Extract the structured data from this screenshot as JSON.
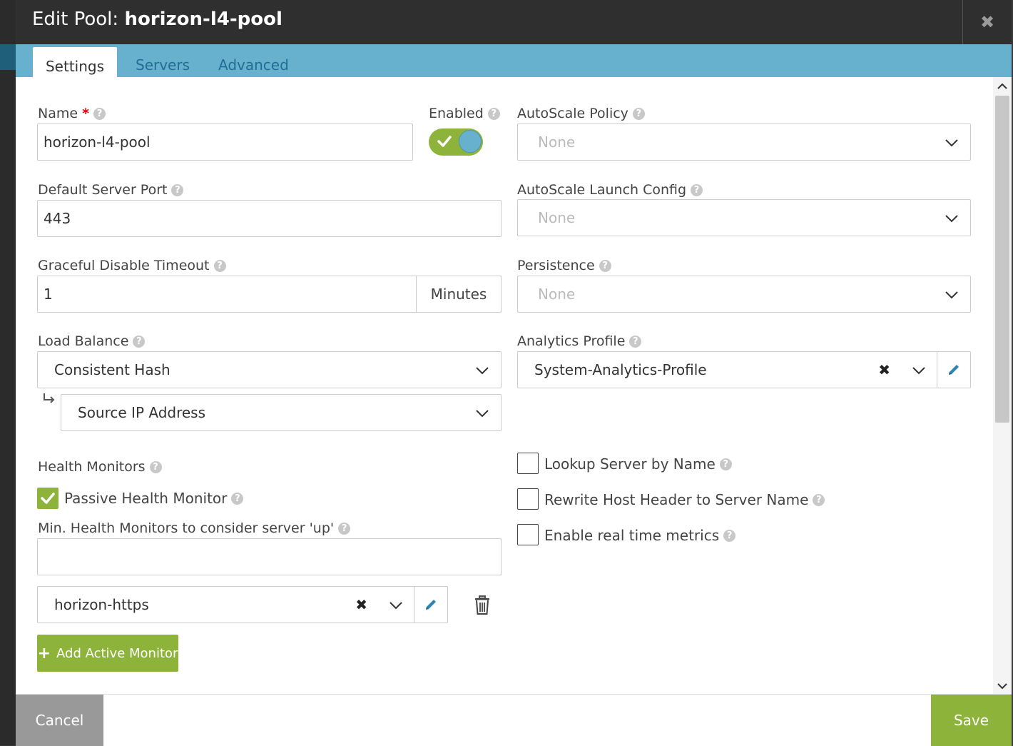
{
  "dialog": {
    "title_prefix": "Edit Pool: ",
    "title_name": "horizon-l4-pool",
    "close_symbol": "✖"
  },
  "tabs": [
    {
      "label": "Settings",
      "active": true
    },
    {
      "label": "Servers",
      "active": false
    },
    {
      "label": "Advanced",
      "active": false
    }
  ],
  "form": {
    "name": {
      "label": "Name",
      "required_mark": "*",
      "value": "horizon-l4-pool"
    },
    "enabled": {
      "label": "Enabled",
      "value": true
    },
    "autoscale_policy": {
      "label": "AutoScale Policy",
      "value": "None"
    },
    "default_server_port": {
      "label": "Default Server Port",
      "value": "443"
    },
    "autoscale_launch_config": {
      "label": "AutoScale Launch Config",
      "value": "None"
    },
    "graceful_disable_timeout": {
      "label": "Graceful Disable Timeout",
      "value": "1",
      "unit": "Minutes"
    },
    "persistence": {
      "label": "Persistence",
      "value": "None"
    },
    "load_balance": {
      "label": "Load Balance",
      "value": "Consistent Hash",
      "sub_value": "Source IP Address"
    },
    "analytics_profile": {
      "label": "Analytics Profile",
      "value": "System-Analytics-Profile"
    },
    "health_monitors": {
      "label": "Health Monitors"
    },
    "passive_health_monitor": {
      "label": "Passive Health Monitor",
      "checked": true
    },
    "min_health_monitors": {
      "label": "Min. Health Monitors to consider server 'up'",
      "value": ""
    },
    "active_monitor": {
      "value": "horizon-https"
    },
    "add_active_monitor": {
      "label": "Add Active Monitor"
    },
    "lookup_server_by_name": {
      "label": "Lookup Server by Name",
      "checked": false
    },
    "rewrite_host_header": {
      "label": "Rewrite Host Header to Server Name",
      "checked": false
    },
    "enable_real_time_metrics": {
      "label": "Enable real time metrics",
      "checked": false
    }
  },
  "help_symbol": "?",
  "footer": {
    "cancel_label": "Cancel",
    "save_label": "Save"
  },
  "colors": {
    "accent_green": "#8db33a",
    "tab_blue": "#67b1cf",
    "title_bar": "#2f2f2f"
  }
}
